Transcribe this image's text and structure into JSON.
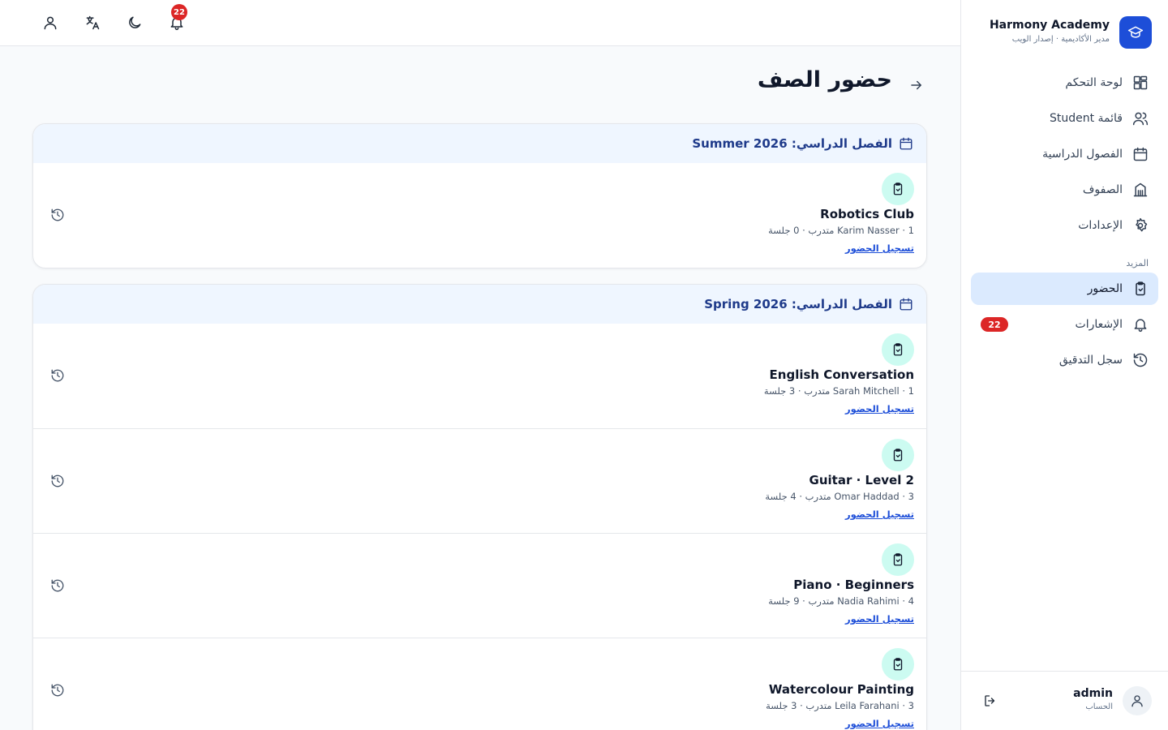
{
  "brand": {
    "name": "Harmony Academy",
    "subtitle": "مدير الأكاديمية · إصدار الويب"
  },
  "sidebar": {
    "items": [
      {
        "label": "لوحة التحكم",
        "icon": "dashboard-icon"
      },
      {
        "label": "قائمة Student",
        "icon": "users-icon"
      },
      {
        "label": "الفصول الدراسية",
        "icon": "calendar-icon"
      },
      {
        "label": "الصفوف",
        "icon": "building-icon"
      },
      {
        "label": "الإعدادات",
        "icon": "gear-icon"
      }
    ],
    "section_more": "المزيد",
    "more_items": [
      {
        "label": "الحضور",
        "icon": "clipboard-check-icon",
        "active": true
      },
      {
        "label": "الإشعارات",
        "icon": "bell-icon",
        "badge": "22"
      },
      {
        "label": "سجل التدقيق",
        "icon": "history-icon"
      }
    ]
  },
  "account": {
    "name": "admin",
    "subtitle": "الحساب"
  },
  "topbar": {
    "notification_count": "22"
  },
  "page": {
    "title": "حضور الصف"
  },
  "terms": [
    {
      "title": "الفصل الدراسي: Summer 2026",
      "classes": [
        {
          "name": "Robotics Club",
          "meta": "1 · Karim Nasser متدرب · 0 جلسة",
          "action": "تسجيل الحضور"
        }
      ]
    },
    {
      "title": "الفصل الدراسي: Spring 2026",
      "classes": [
        {
          "name": "English Conversation",
          "meta": "1 · Sarah Mitchell متدرب · 3 جلسة",
          "action": "تسجيل الحضور"
        },
        {
          "name": "Guitar · Level 2",
          "meta": "3 · Omar Haddad متدرب · 4 جلسة",
          "action": "تسجيل الحضور"
        },
        {
          "name": "Piano · Beginners",
          "meta": "4 · Nadia Rahimi متدرب · 9 جلسة",
          "action": "تسجيل الحضور"
        },
        {
          "name": "Watercolour Painting",
          "meta": "3 · Leila Farahani متدرب · 3 جلسة",
          "action": "تسجيل الحضور"
        }
      ]
    }
  ],
  "colors": {
    "accent": "#1d4ed8",
    "active_nav_bg": "#dbeafe",
    "term_header_bg": "#eff6ff",
    "badge": "#dc2626",
    "class_icon_bg": "#ccfbf1"
  }
}
